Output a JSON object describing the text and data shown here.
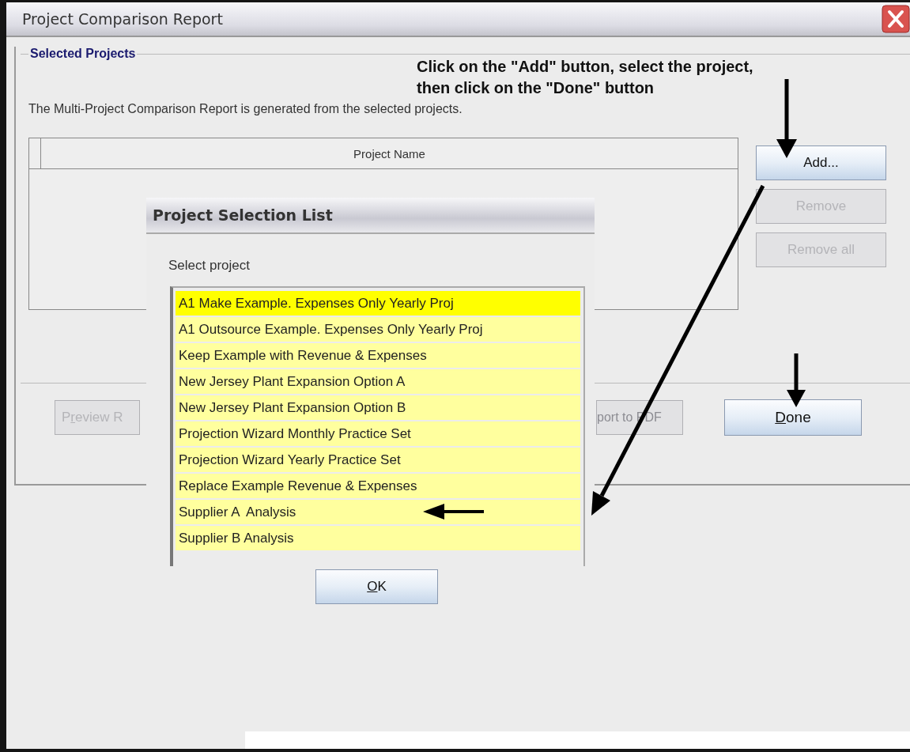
{
  "window": {
    "title": "Project Comparison Report"
  },
  "group": {
    "title": "Selected Projects"
  },
  "instruction": "Click on the \"Add\" button, select the project,\nthen click on the \"Done\" button",
  "description": "The Multi-Project Comparison Report is generated from the selected projects.",
  "table": {
    "columns": [
      "Project Name"
    ]
  },
  "side_buttons": [
    {
      "label": "Add...",
      "disabled": false
    },
    {
      "label": "Remove",
      "disabled": true
    },
    {
      "label": "Remove all",
      "disabled": true
    }
  ],
  "bottom_buttons": [
    {
      "label": [
        {
          "text": "P",
          "underlined": false
        },
        {
          "text": "r",
          "underlined": true
        },
        {
          "text": "eview R",
          "underlined": false
        }
      ],
      "disabled": true
    },
    {
      "label": [
        {
          "text": "port to PDF",
          "underlined": false
        }
      ],
      "disabled": true
    },
    {
      "label": [
        {
          "text": "D",
          "underlined": true
        },
        {
          "text": "one",
          "underlined": false
        }
      ],
      "disabled": false
    }
  ],
  "dialog": {
    "title": "Project Selection List",
    "prompt": "Select project",
    "items": [
      {
        "label": "A1 Make Example. Expenses Only Yearly Proj",
        "selected": true
      },
      {
        "label": "A1 Outsource Example. Expenses Only Yearly Proj",
        "selected": false
      },
      {
        "label": "Keep Example with Revenue & Expenses",
        "selected": false
      },
      {
        "label": "New Jersey Plant Expansion Option A",
        "selected": false
      },
      {
        "label": "New Jersey Plant Expansion Option B",
        "selected": false
      },
      {
        "label": "Projection Wizard Monthly Practice Set",
        "selected": false
      },
      {
        "label": "Projection Wizard Yearly Practice Set",
        "selected": false
      },
      {
        "label": "Replace Example Revenue & Expenses",
        "selected": false
      },
      {
        "label": "Supplier A  Analysis",
        "selected": false
      },
      {
        "label": "Supplier B Analysis",
        "selected": false
      }
    ],
    "ok_button": {
      "label": [
        {
          "text": "O",
          "underlined": true
        },
        {
          "text": "K",
          "underlined": false
        }
      ]
    }
  }
}
